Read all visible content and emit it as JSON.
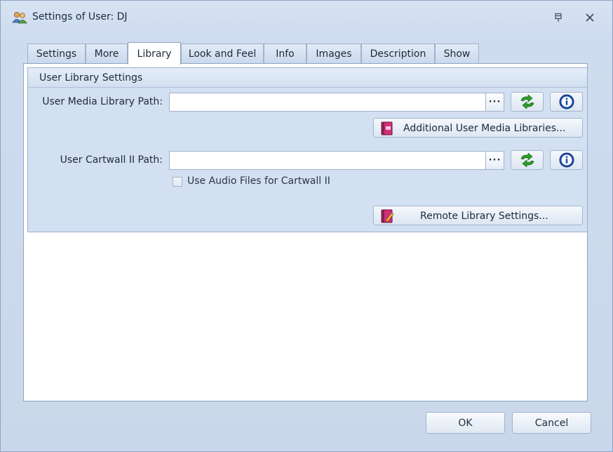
{
  "window": {
    "title": "Settings of User: DJ",
    "icon": "users-icon"
  },
  "tabs": [
    {
      "label": "Settings",
      "active": false
    },
    {
      "label": "More",
      "active": false
    },
    {
      "label": "Library",
      "active": true
    },
    {
      "label": "Look and Feel",
      "active": false
    },
    {
      "label": "Info",
      "active": false
    },
    {
      "label": "Images",
      "active": false
    },
    {
      "label": "Description",
      "active": false
    },
    {
      "label": "Show",
      "active": false
    }
  ],
  "library": {
    "group_title": "User Library Settings",
    "media_path": {
      "label": "User Media Library Path:",
      "value": "",
      "browse_label": "···"
    },
    "additional_button": "Additional User Media Libraries...",
    "cartwall_path": {
      "label": "User Cartwall II Path:",
      "value": "",
      "browse_label": "···"
    },
    "use_audio_checkbox": {
      "label": "Use Audio Files for Cartwall II",
      "checked": false
    },
    "remote_button": "Remote Library Settings..."
  },
  "footer": {
    "ok_label": "OK",
    "cancel_label": "Cancel"
  },
  "colors": {
    "window_bg": "#cfdcef",
    "panel_bg": "#d3e0f1",
    "refresh_green": "#2e9e2a",
    "info_blue": "#1e4fb0",
    "library_icon_pink": "#d0307a"
  }
}
